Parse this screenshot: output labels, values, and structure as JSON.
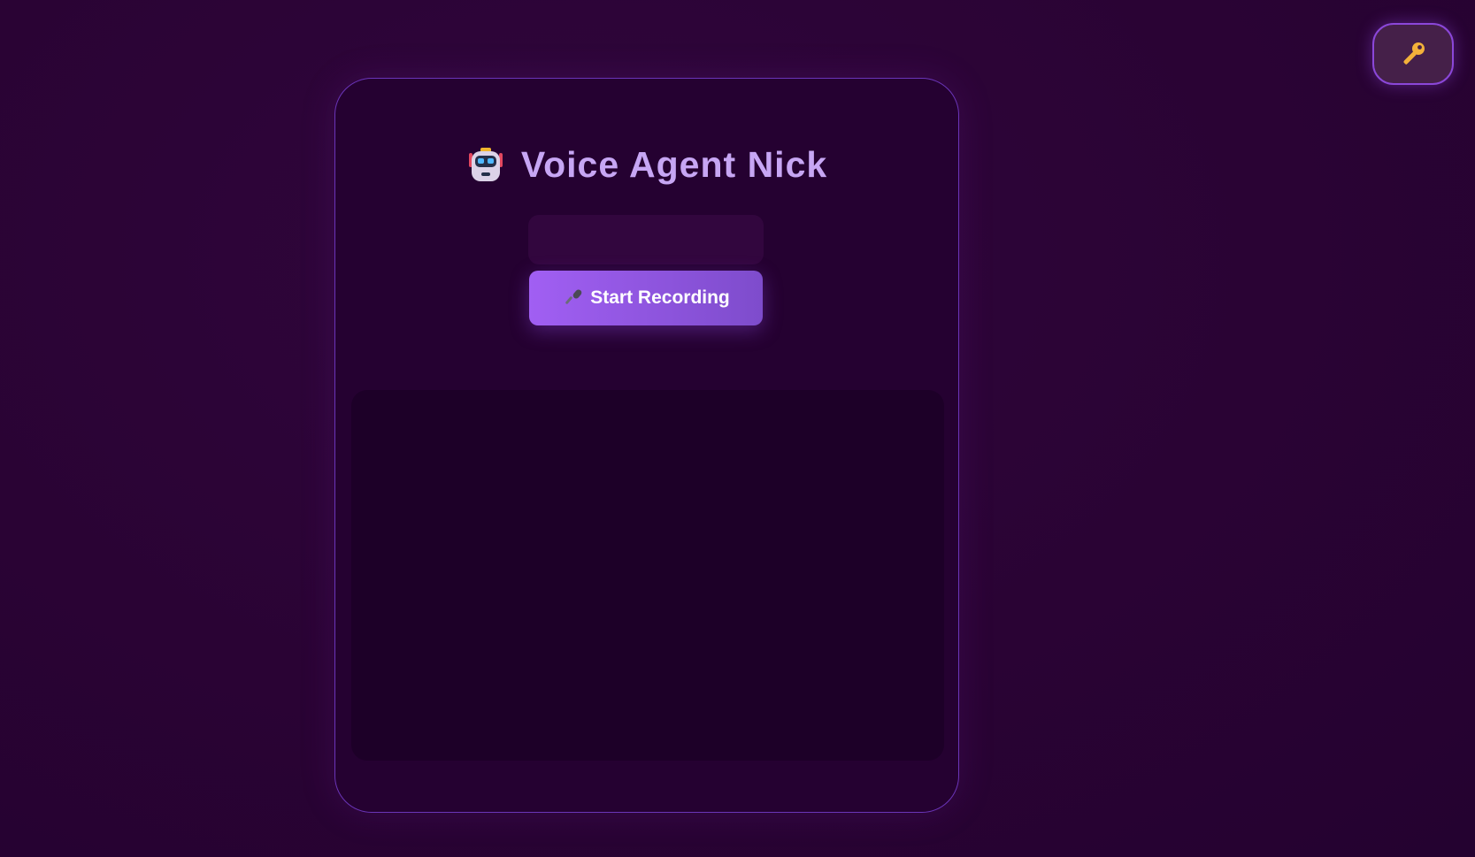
{
  "header": {
    "title": "Voice Agent Nick",
    "title_icon": "robot-icon"
  },
  "controls": {
    "record_label": "Start Recording",
    "record_icon": "microphone-icon"
  },
  "status": {
    "text": ""
  },
  "transcript": {
    "messages": []
  },
  "settings": {
    "api_key_icon": "key-icon"
  },
  "theme": {
    "background": "#2b0336",
    "card_background": "#250131",
    "card_border": "#6a35b8",
    "title_color": "#c7a6f4",
    "button_gradient_start": "#a15ff3",
    "button_gradient_end": "#7e4ccc",
    "accent": "#8b47d9"
  }
}
